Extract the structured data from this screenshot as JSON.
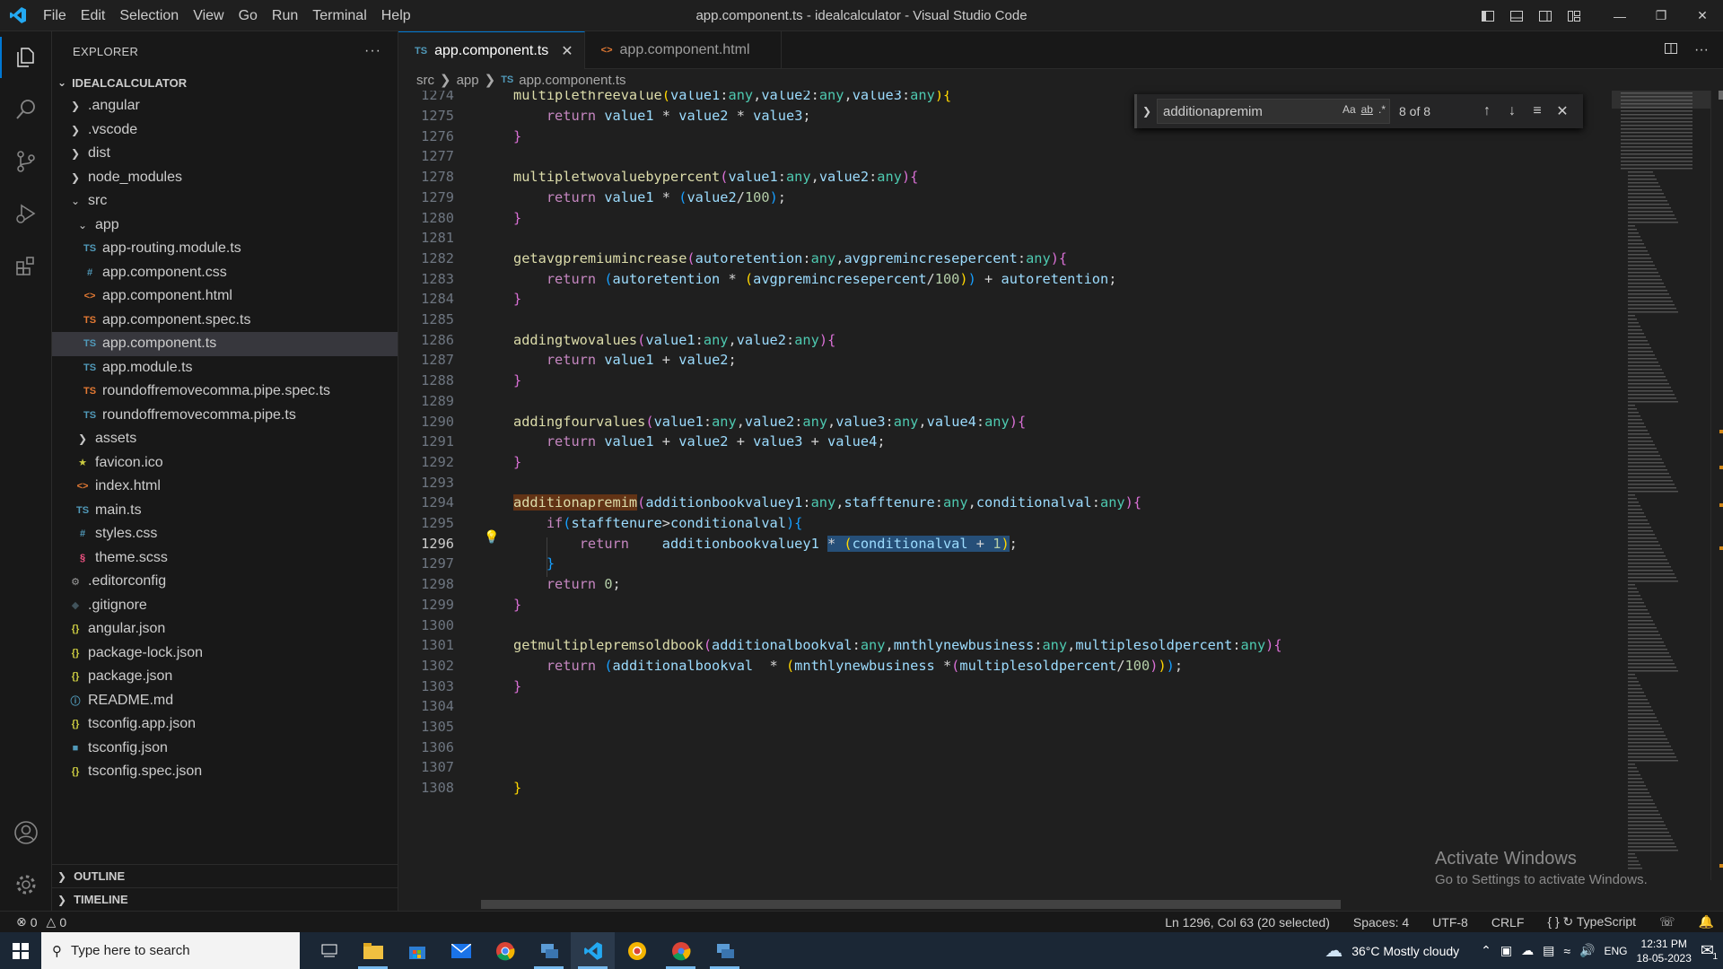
{
  "window": {
    "title": "app.component.ts - idealcalculator - Visual Studio Code",
    "menu": [
      "File",
      "Edit",
      "Selection",
      "View",
      "Go",
      "Run",
      "Terminal",
      "Help"
    ]
  },
  "sidebar": {
    "header": "EXPLORER",
    "root": "IDEALCALCULATOR",
    "items": [
      {
        "label": ".angular",
        "kind": "folder",
        "depth": 1,
        "icon": "chevron-right-icon"
      },
      {
        "label": ".vscode",
        "kind": "folder",
        "depth": 1,
        "icon": "chevron-right-icon"
      },
      {
        "label": "dist",
        "kind": "folder",
        "depth": 1,
        "icon": "chevron-right-icon"
      },
      {
        "label": "node_modules",
        "kind": "folder",
        "depth": 1,
        "icon": "chevron-right-icon"
      },
      {
        "label": "src",
        "kind": "folder-open",
        "depth": 1,
        "icon": "chevron-down-icon"
      },
      {
        "label": "app",
        "kind": "folder-open",
        "depth": 2,
        "icon": "chevron-down-icon"
      },
      {
        "label": "app-routing.module.ts",
        "kind": "ts",
        "depth": 3,
        "badge": "TS",
        "badgeColor": "#519aba"
      },
      {
        "label": "app.component.css",
        "kind": "css",
        "depth": 3,
        "badge": "#",
        "badgeColor": "#519aba"
      },
      {
        "label": "app.component.html",
        "kind": "html",
        "depth": 3,
        "badge": "<>",
        "badgeColor": "#e37933"
      },
      {
        "label": "app.component.spec.ts",
        "kind": "spec",
        "depth": 3,
        "badge": "TS",
        "badgeColor": "#e37933"
      },
      {
        "label": "app.component.ts",
        "kind": "ts",
        "depth": 3,
        "badge": "TS",
        "badgeColor": "#519aba",
        "selected": true
      },
      {
        "label": "app.module.ts",
        "kind": "ts",
        "depth": 3,
        "badge": "TS",
        "badgeColor": "#519aba"
      },
      {
        "label": "roundoffremovecomma.pipe.spec.ts",
        "kind": "spec",
        "depth": 3,
        "badge": "TS",
        "badgeColor": "#e37933"
      },
      {
        "label": "roundoffremovecomma.pipe.ts",
        "kind": "ts",
        "depth": 3,
        "badge": "TS",
        "badgeColor": "#519aba"
      },
      {
        "label": "assets",
        "kind": "folder",
        "depth": 2,
        "icon": "chevron-right-icon"
      },
      {
        "label": "favicon.ico",
        "kind": "ico",
        "depth": 2,
        "badge": "★",
        "badgeColor": "#cbcb41"
      },
      {
        "label": "index.html",
        "kind": "html",
        "depth": 2,
        "badge": "<>",
        "badgeColor": "#e37933"
      },
      {
        "label": "main.ts",
        "kind": "ts",
        "depth": 2,
        "badge": "TS",
        "badgeColor": "#519aba"
      },
      {
        "label": "styles.css",
        "kind": "css",
        "depth": 2,
        "badge": "#",
        "badgeColor": "#519aba"
      },
      {
        "label": "theme.scss",
        "kind": "scss",
        "depth": 2,
        "badge": "§",
        "badgeColor": "#f55385"
      },
      {
        "label": ".editorconfig",
        "kind": "config",
        "depth": 1,
        "badge": "⚙",
        "badgeColor": "#9d9d9d"
      },
      {
        "label": ".gitignore",
        "kind": "git",
        "depth": 1,
        "badge": "◆",
        "badgeColor": "#41535b"
      },
      {
        "label": "angular.json",
        "kind": "json",
        "depth": 1,
        "badge": "{}",
        "badgeColor": "#cbcb41"
      },
      {
        "label": "package-lock.json",
        "kind": "json",
        "depth": 1,
        "badge": "{}",
        "badgeColor": "#cbcb41"
      },
      {
        "label": "package.json",
        "kind": "json",
        "depth": 1,
        "badge": "{}",
        "badgeColor": "#cbcb41"
      },
      {
        "label": "README.md",
        "kind": "md",
        "depth": 1,
        "badge": "ⓘ",
        "badgeColor": "#519aba"
      },
      {
        "label": "tsconfig.app.json",
        "kind": "json",
        "depth": 1,
        "badge": "{}",
        "badgeColor": "#cbcb41"
      },
      {
        "label": "tsconfig.json",
        "kind": "tsconfig",
        "depth": 1,
        "badge": "■",
        "badgeColor": "#519aba"
      },
      {
        "label": "tsconfig.spec.json",
        "kind": "json",
        "depth": 1,
        "badge": "{}",
        "badgeColor": "#cbcb41"
      }
    ],
    "sections": [
      "OUTLINE",
      "TIMELINE"
    ]
  },
  "tabs": [
    {
      "label": "app.component.ts",
      "badge": "TS",
      "badgeColor": "#519aba",
      "active": true
    },
    {
      "label": "app.component.html",
      "badge": "<>",
      "badgeColor": "#e37933",
      "active": false
    }
  ],
  "breadcrumb": [
    "src",
    "app",
    "app.component.ts"
  ],
  "breadcrumb_badge": "TS",
  "find": {
    "query": "additionapremim",
    "opt_case": "Aa",
    "opt_word": "ab",
    "opt_regex": ".*",
    "count": "8 of 8"
  },
  "code": {
    "current_line": 1296,
    "lines": [
      {
        "n": "1274",
        "html": "<span class='fn'>multiplethreevalue</span><span class='br1'>(</span><span class='var'>value1</span>:<span class='ty'>any</span>,<span class='var'>value2</span>:<span class='ty'>any</span>,<span class='var'>value3</span>:<span class='ty'>any</span><span class='br1'>)</span><span class='br1'>{</span>"
      },
      {
        "n": "1275",
        "html": "    <span class='kw'>return</span> <span class='var'>value1</span> * <span class='var'>value2</span> * <span class='var'>value3</span>;"
      },
      {
        "n": "1276",
        "html": "<span class='br2'>}</span>"
      },
      {
        "n": "1277",
        "html": ""
      },
      {
        "n": "1278",
        "html": "<span class='fn'>multipletwovaluebypercent</span><span class='br2'>(</span><span class='var'>value1</span>:<span class='ty'>any</span>,<span class='var'>value2</span>:<span class='ty'>any</span><span class='br2'>)</span><span class='br2'>{</span>"
      },
      {
        "n": "1279",
        "html": "    <span class='kw'>return</span> <span class='var'>value1</span> * <span class='br3'>(</span><span class='var'>value2</span>/<span class='num'>100</span><span class='br3'>)</span>;"
      },
      {
        "n": "1280",
        "html": "<span class='br2'>}</span>"
      },
      {
        "n": "1281",
        "html": ""
      },
      {
        "n": "1282",
        "html": "<span class='fn'>getavgpremiumincrease</span><span class='br2'>(</span><span class='var'>autoretention</span>:<span class='ty'>any</span>,<span class='var'>avgpremincresepercent</span>:<span class='ty'>any</span><span class='br2'>)</span><span class='br2'>{</span>"
      },
      {
        "n": "1283",
        "html": "    <span class='kw'>return</span> <span class='br3'>(</span><span class='var'>autoretention</span> * <span class='br1'>(</span><span class='var'>avgpremincresepercent</span>/<span class='num'>100</span><span class='br1'>)</span><span class='br3'>)</span> + <span class='var'>autoretention</span>;"
      },
      {
        "n": "1284",
        "html": "<span class='br2'>}</span>"
      },
      {
        "n": "1285",
        "html": ""
      },
      {
        "n": "1286",
        "html": "<span class='fn'>addingtwovalues</span><span class='br2'>(</span><span class='var'>value1</span>:<span class='ty'>any</span>,<span class='var'>value2</span>:<span class='ty'>any</span><span class='br2'>)</span><span class='br2'>{</span>"
      },
      {
        "n": "1287",
        "html": "    <span class='kw'>return</span> <span class='var'>value1</span> + <span class='var'>value2</span>;"
      },
      {
        "n": "1288",
        "html": "<span class='br2'>}</span>"
      },
      {
        "n": "1289",
        "html": ""
      },
      {
        "n": "1290",
        "html": "<span class='fn'>addingfourvalues</span><span class='br2'>(</span><span class='var'>value1</span>:<span class='ty'>any</span>,<span class='var'>value2</span>:<span class='ty'>any</span>,<span class='var'>value3</span>:<span class='ty'>any</span>,<span class='var'>value4</span>:<span class='ty'>any</span><span class='br2'>)</span><span class='br2'>{</span>"
      },
      {
        "n": "1291",
        "html": "    <span class='kw'>return</span> <span class='var'>value1</span> + <span class='var'>value2</span> + <span class='var'>value3</span> + <span class='var'>value4</span>;"
      },
      {
        "n": "1292",
        "html": "<span class='br2'>}</span>"
      },
      {
        "n": "1293",
        "html": ""
      },
      {
        "n": "1294",
        "html": "<span class='fn hl'>additionapremim</span><span class='br2'>(</span><span class='var'>additionbookvaluey1</span>:<span class='ty'>any</span>,<span class='var'>stafftenure</span>:<span class='ty'>any</span>,<span class='var'>conditionalval</span>:<span class='ty'>any</span><span class='br2'>)</span><span class='br2'>{</span>"
      },
      {
        "n": "1295",
        "html": "    <span class='kw'>if</span><span class='br3'>(</span><span class='var'>stafftenure</span>&gt;<span class='var'>conditionalval</span><span class='br3'>)</span><span class='br3'>{</span>"
      },
      {
        "n": "1296",
        "html": "        <span class='kw'>return</span>    <span class='var'>additionbookvaluey1</span> <span class='sel'>* <span class='br1'>(</span><span class='var'>conditionalval</span> + <span class='num'>1</span><span class='br1'>)</span></span>;"
      },
      {
        "n": "1297",
        "html": "    <span class='br3'>}</span>"
      },
      {
        "n": "1298",
        "html": "    <span class='kw'>return</span> <span class='num'>0</span>;"
      },
      {
        "n": "1299",
        "html": "<span class='br2'>}</span>"
      },
      {
        "n": "1300",
        "html": ""
      },
      {
        "n": "1301",
        "html": "<span class='fn'>getmultiplepremsoldbook</span><span class='br2'>(</span><span class='var'>additionalbookval</span>:<span class='ty'>any</span>,<span class='var'>mnthlynewbusiness</span>:<span class='ty'>any</span>,<span class='var'>multiplesoldpercent</span>:<span class='ty'>any</span><span class='br2'>)</span><span class='br2'>{</span>"
      },
      {
        "n": "1302",
        "html": "    <span class='kw'>return</span> <span class='br3'>(</span><span class='var'>additionalbookval</span>  * <span class='br1'>(</span><span class='var'>mnthlynewbusiness</span> *<span class='br2'>(</span><span class='var'>multiplesoldpercent</span>/<span class='num'>100</span><span class='br2'>)</span><span class='br1'>)</span><span class='br3'>)</span>;"
      },
      {
        "n": "1303",
        "html": "<span class='br2'>}</span>"
      },
      {
        "n": "1304",
        "html": ""
      },
      {
        "n": "1305",
        "html": ""
      },
      {
        "n": "1306",
        "html": ""
      },
      {
        "n": "1307",
        "html": ""
      },
      {
        "n": "1308",
        "html": "<span class='br1'>}</span>"
      }
    ]
  },
  "watermark": {
    "title": "Activate Windows",
    "subtitle": "Go to Settings to activate Windows."
  },
  "status": {
    "errors": "0",
    "warnings": "0",
    "position": "Ln 1296, Col 63 (20 selected)",
    "spaces": "Spaces: 4",
    "encoding": "UTF-8",
    "eol": "CRLF",
    "language": "TypeScript"
  },
  "taskbar": {
    "search_placeholder": "Type here to search",
    "weather": "36°C  Mostly cloudy",
    "lang": "ENG",
    "time": "12:31 PM",
    "date": "18-05-2023",
    "notifications": "1"
  },
  "colors": {
    "accent": "#0078d4",
    "selection": "#264f78",
    "find_match": "#623315"
  }
}
